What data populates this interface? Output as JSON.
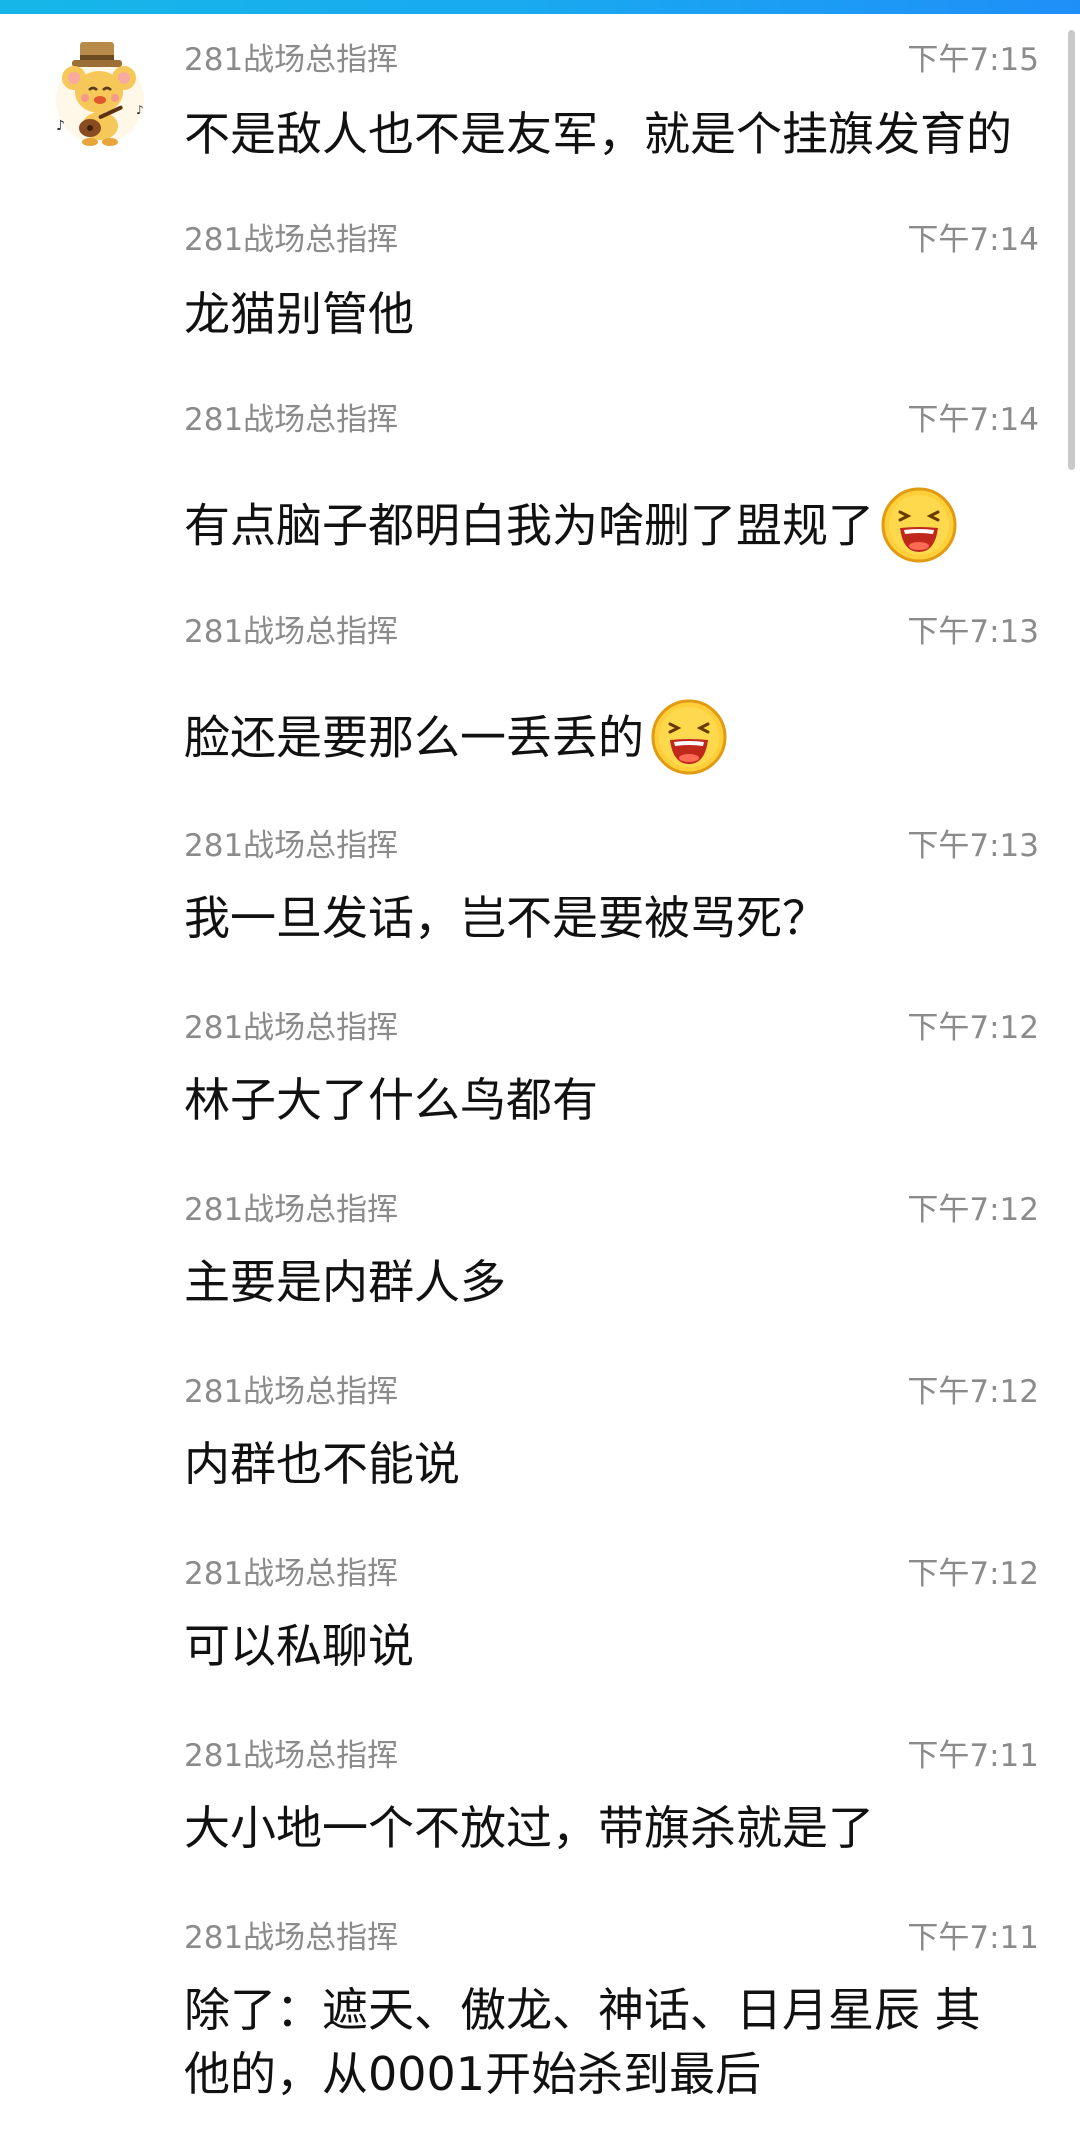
{
  "chat": {
    "messages": [
      {
        "sender": "281战场总指挥",
        "time": "下午7:15",
        "text": "不是敌人也不是友军，就是个挂旗发育的",
        "emoji": ""
      },
      {
        "sender": "281战场总指挥",
        "time": "下午7:14",
        "text": "龙猫别管他",
        "emoji": ""
      },
      {
        "sender": "281战场总指挥",
        "time": "下午7:14",
        "text": "有点脑子都明白我为啥删了盟规了",
        "emoji": "laughing-face"
      },
      {
        "sender": "281战场总指挥",
        "time": "下午7:13",
        "text": "脸还是要那么一丢丢的",
        "emoji": "laughing-face"
      },
      {
        "sender": "281战场总指挥",
        "time": "下午7:13",
        "text": "我一旦发话，岂不是要被骂死？",
        "emoji": ""
      },
      {
        "sender": "281战场总指挥",
        "time": "下午7:12",
        "text": "林子大了什么鸟都有",
        "emoji": ""
      },
      {
        "sender": "281战场总指挥",
        "time": "下午7:12",
        "text": "主要是内群人多",
        "emoji": ""
      },
      {
        "sender": "281战场总指挥",
        "time": "下午7:12",
        "text": "内群也不能说",
        "emoji": ""
      },
      {
        "sender": "281战场总指挥",
        "time": "下午7:12",
        "text": "可以私聊说",
        "emoji": ""
      },
      {
        "sender": "281战场总指挥",
        "time": "下午7:11",
        "text": "大小地一个不放过，带旗杀就是了",
        "emoji": ""
      },
      {
        "sender": "281战场总指挥",
        "time": "下午7:11",
        "text": "除了：遮天、傲龙、神话、日月星辰 其他的，从0001开始杀到最后",
        "emoji": ""
      }
    ]
  },
  "colors": {
    "top_bar": "#1aa6f0",
    "meta_text": "#8b8b8b",
    "message_text": "#111111"
  },
  "icons": {
    "avatar": "cartoon-mouse-with-guitar-avatar",
    "emoji": "laughing-face-emoji"
  }
}
